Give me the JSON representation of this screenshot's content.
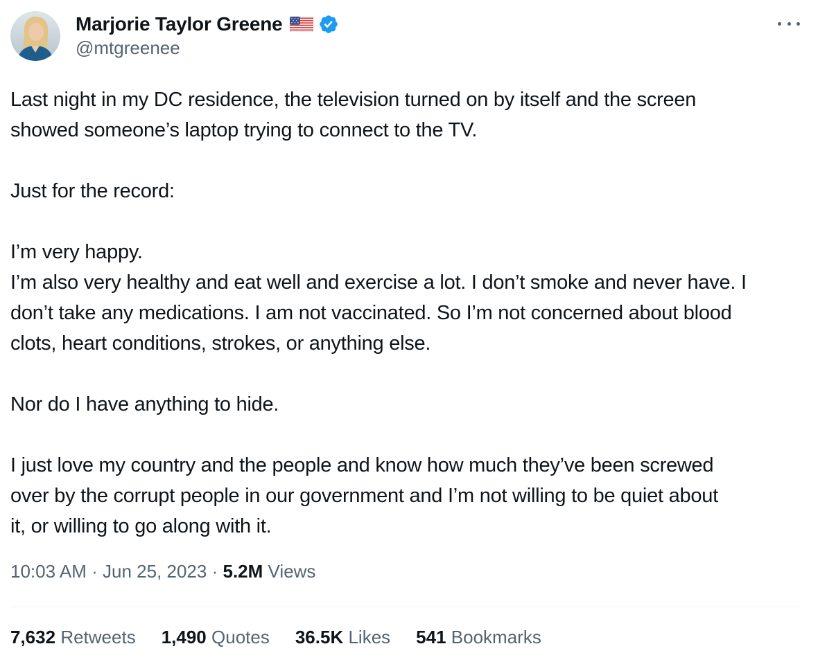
{
  "author": {
    "name": "Marjorie Taylor Greene",
    "handle": "@mtgreenee",
    "flag_icon": "us-flag-icon",
    "verified_icon": "verified-badge-icon",
    "verified_color": "#1d9bf0"
  },
  "tweet": {
    "paragraphs": [
      [
        "Last night in my DC residence, the television turned on by itself and the screen",
        "showed someone’s laptop trying to connect to the TV."
      ],
      [
        "Just for the record:"
      ],
      [
        "I’m very happy.",
        "I’m also very healthy and eat well and exercise a lot. I don’t smoke and never have. I",
        "don’t take any medications. I am not vaccinated. So I’m not concerned about blood",
        "clots, heart conditions, strokes, or anything else."
      ],
      [
        "Nor do I have anything to hide."
      ],
      [
        "I just love my country and the people and know how much they’ve been screwed",
        "over by the corrupt people in our government and I’m not willing to be quiet about",
        "it, or willing to go along with it."
      ]
    ]
  },
  "meta": {
    "time": "10:03 AM",
    "separator": "·",
    "date": "Jun 25, 2023",
    "views_count": "5.2M",
    "views_label": "Views"
  },
  "stats": {
    "retweets": {
      "count": "7,632",
      "label": "Retweets"
    },
    "quotes": {
      "count": "1,490",
      "label": "Quotes"
    },
    "likes": {
      "count": "36.5K",
      "label": "Likes"
    },
    "bookmarks": {
      "count": "541",
      "label": "Bookmarks"
    }
  },
  "colors": {
    "text_primary": "#0f1419",
    "text_secondary": "#536471",
    "divider": "#eff3f4"
  },
  "icons": {
    "more": "more-options-icon"
  }
}
